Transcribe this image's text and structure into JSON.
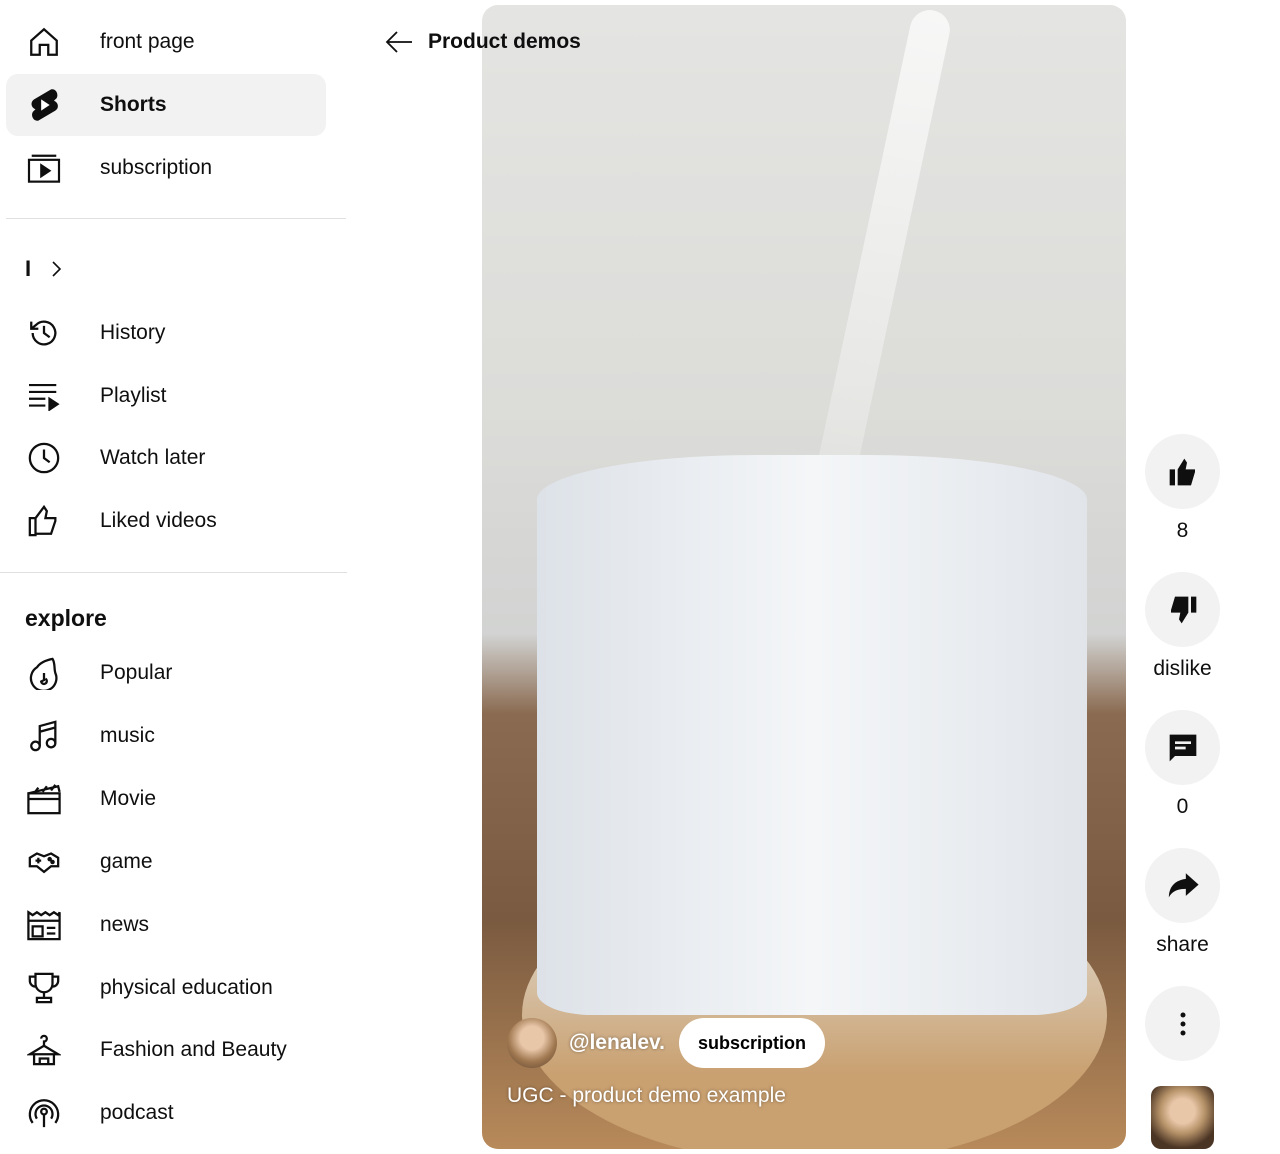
{
  "sidebar": {
    "main": [
      {
        "label": "front page",
        "icon": "home-icon"
      },
      {
        "label": "Shorts",
        "icon": "shorts-icon",
        "active": true
      },
      {
        "label": "subscription",
        "icon": "subscriptions-icon"
      }
    ],
    "you_label": "I",
    "you": [
      {
        "label": "History",
        "icon": "history-icon"
      },
      {
        "label": "Playlist",
        "icon": "playlist-icon"
      },
      {
        "label": "Watch later",
        "icon": "watch-later-icon"
      },
      {
        "label": "Liked videos",
        "icon": "like-icon"
      }
    ],
    "explore_title": "explore",
    "explore": [
      {
        "label": "Popular",
        "icon": "fire-icon"
      },
      {
        "label": "music",
        "icon": "music-icon"
      },
      {
        "label": "Movie",
        "icon": "clapperboard-icon"
      },
      {
        "label": "game",
        "icon": "gamepad-icon"
      },
      {
        "label": "news",
        "icon": "newspaper-icon"
      },
      {
        "label": "physical education",
        "icon": "trophy-icon"
      },
      {
        "label": "Fashion and Beauty",
        "icon": "hanger-icon"
      },
      {
        "label": "podcast",
        "icon": "podcast-icon"
      }
    ]
  },
  "header": {
    "back_label": "Product demos"
  },
  "video": {
    "channel": "@lenalev.",
    "subscribe_label": "subscription",
    "title": "UGC - product demo example"
  },
  "actions": {
    "likes": "8",
    "dislike_label": "dislike",
    "comments": "0",
    "share_label": "share"
  }
}
